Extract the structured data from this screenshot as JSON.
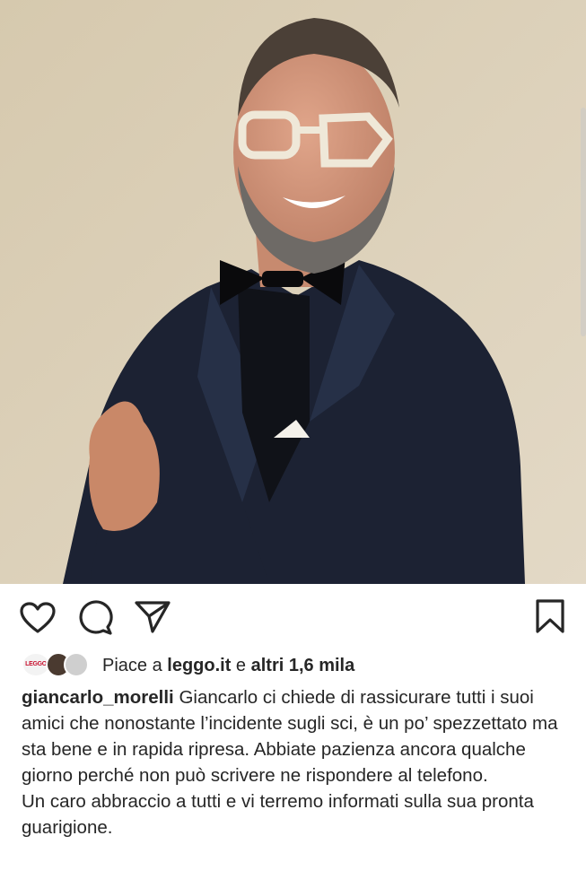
{
  "post": {
    "photo_alt": "post-photo",
    "actions": {
      "like_icon": "heart-outline-icon",
      "comment_icon": "comment-bubble-icon",
      "share_icon": "paper-plane-icon",
      "save_icon": "bookmark-outline-icon"
    },
    "likes": {
      "prefix": "Piace a ",
      "first_liker": "leggo.it",
      "connector": " e ",
      "others": "altri 1,6 mila",
      "avatar1_text": "LEGGO"
    },
    "caption": {
      "username": "giancarlo_morelli",
      "text_line1": " Giancarlo ci chiede di rassicurare tutti i suoi amici che nonostante l’incidente sugli sci, è un po’ spezzettato ma sta bene e in rapida ripresa. Abbiate pazienza ancora qualche giorno  perché non può scrivere ne rispondere al telefono.",
      "text_line2": "Un caro abbraccio a tutti e vi terremo informati sulla sua pronta guarigione."
    }
  },
  "colors": {
    "text": "#262626",
    "background": "#ffffff",
    "wall": "#d9cdb3",
    "suit": "#1c2233"
  }
}
